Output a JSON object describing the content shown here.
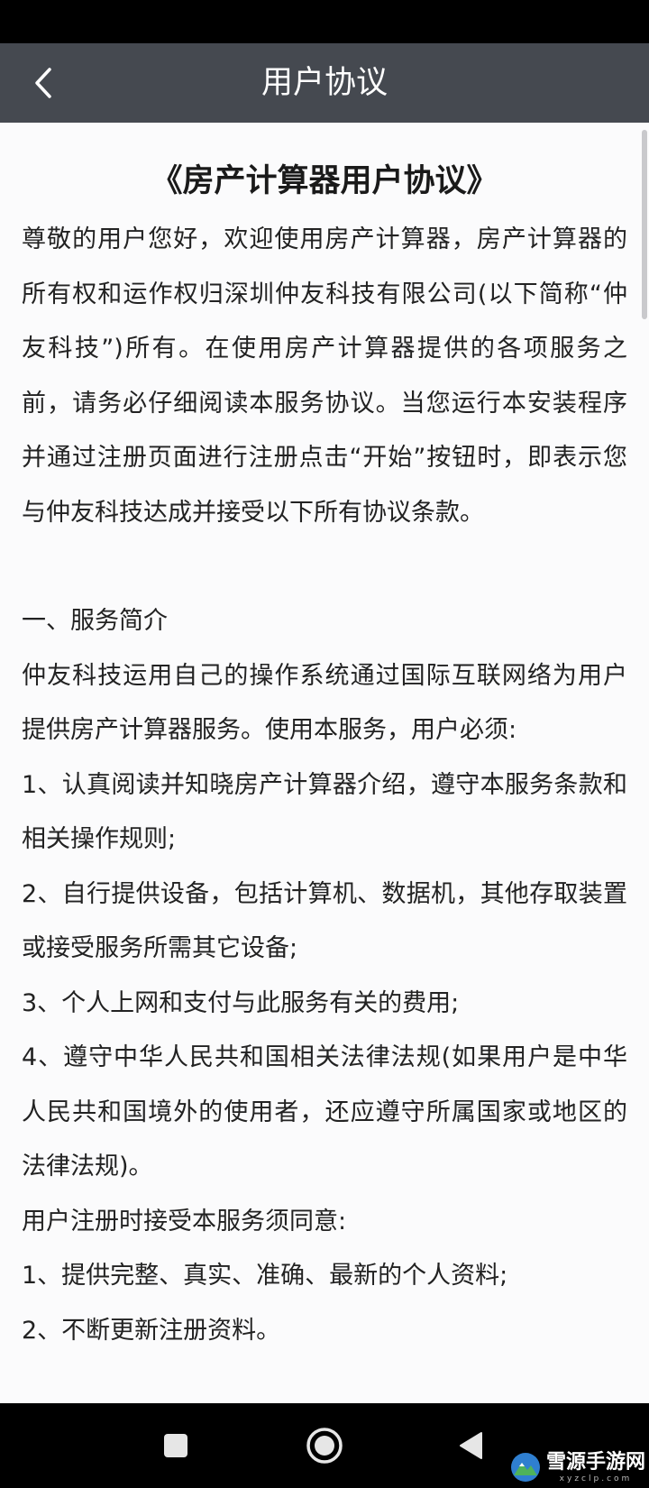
{
  "header": {
    "title": "用户协议"
  },
  "document": {
    "title": "《房产计算器用户协议》",
    "intro": "尊敬的用户您好，欢迎使用房产计算器，房产计算器的所有权和运作权归深圳仲友科技有限公司(以下简称“仲友科技”)所有。在使用房产计算器提供的各项服务之前，请务必仔细阅读本服务协议。当您运行本安装程序并通过注册页面进行注册点击“开始”按钮时，即表示您与仲友科技达成并接受以下所有协议条款。",
    "section1_heading": "一、服务简介",
    "section1_paragraphs": [
      "仲友科技运用自己的操作系统通过国际互联网络为用户提供房产计算器服务。使用本服务，用户必须:",
      "1、认真阅读并知晓房产计算器介绍，遵守本服务条款和相关操作规则;",
      "2、自行提供设备，包括计算机、数据机，其他存取装置或接受服务所需其它设备;",
      "3、个人上网和支付与此服务有关的费用;",
      "4、遵守中华人民共和国相关法律法规(如果用户是中华人民共和国境外的使用者，还应遵守所属国家或地区的法律法规)。",
      "用户注册时接受本服务须同意:",
      "1、提供完整、真实、准确、最新的个人资料;",
      "2、不断更新注册资料。"
    ]
  },
  "navigation": {
    "recent_icon": "square-icon",
    "home_icon": "circle-icon",
    "back_icon": "triangle-back-icon"
  },
  "watermark": {
    "title": "雪源手游网",
    "subtitle": "xyzclp.com"
  },
  "colors": {
    "header_bg": "#454950",
    "content_bg": "#fbfbfc",
    "text": "#222222"
  }
}
